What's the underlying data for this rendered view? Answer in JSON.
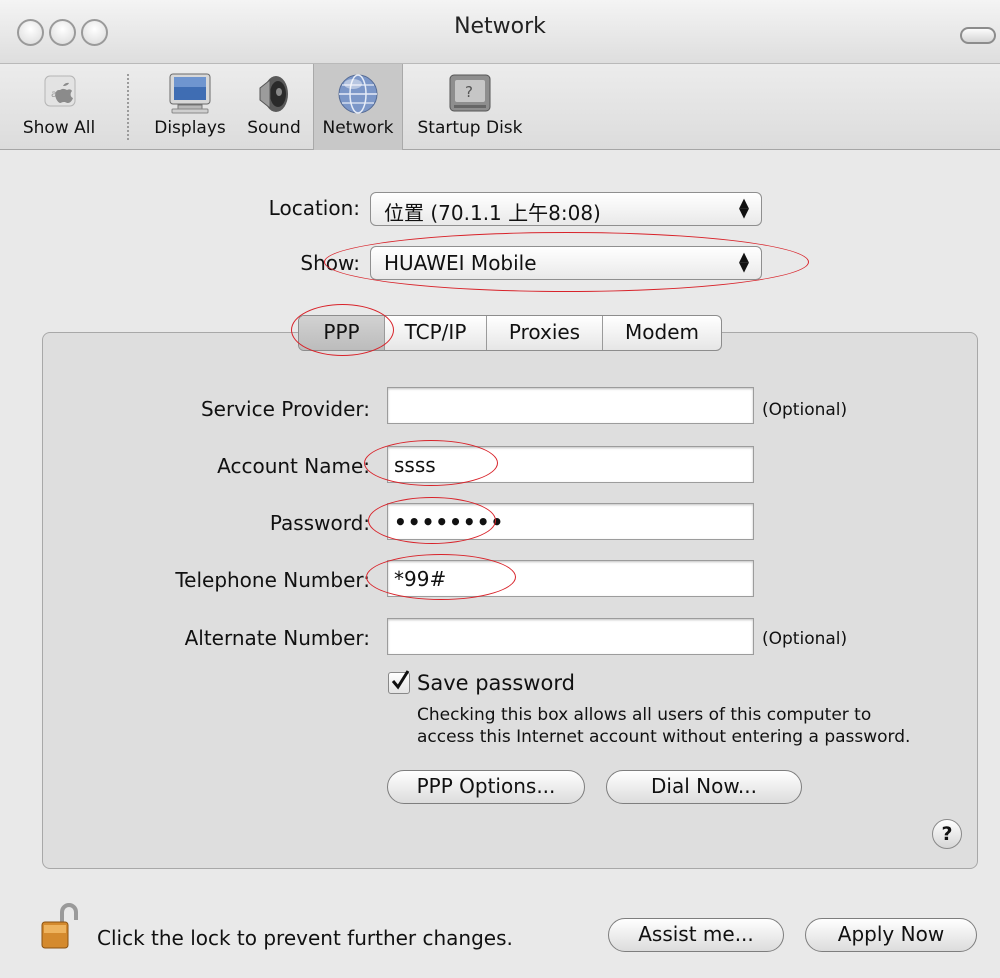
{
  "window": {
    "title": "Network"
  },
  "toolbar": {
    "items": [
      {
        "label": "Show All",
        "icon": "show-all-icon"
      },
      {
        "label": "Displays",
        "icon": "displays-icon"
      },
      {
        "label": "Sound",
        "icon": "sound-icon"
      },
      {
        "label": "Network",
        "icon": "network-icon"
      },
      {
        "label": "Startup Disk",
        "icon": "startup-disk-icon"
      }
    ]
  },
  "location": {
    "label": "Location:",
    "value": "位置 (70.1.1 上午8:08)"
  },
  "show": {
    "label": "Show:",
    "value": "HUAWEI Mobile"
  },
  "tabs": [
    {
      "label": "PPP",
      "selected": true
    },
    {
      "label": "TCP/IP",
      "selected": false
    },
    {
      "label": "Proxies",
      "selected": false
    },
    {
      "label": "Modem",
      "selected": false
    }
  ],
  "form": {
    "service_provider": {
      "label": "Service Provider:",
      "value": "",
      "hint": "(Optional)"
    },
    "account_name": {
      "label": "Account Name:",
      "value": "ssss"
    },
    "password": {
      "label": "Password:",
      "value": "••••••••"
    },
    "telephone_number": {
      "label": "Telephone Number:",
      "value": "*99#"
    },
    "alternate_number": {
      "label": "Alternate Number:",
      "value": "",
      "hint": "(Optional)"
    },
    "save_password": {
      "label": "Save password",
      "checked": true,
      "note_line1": "Checking this box allows all users of this computer to",
      "note_line2": "access this Internet account without entering a password."
    },
    "ppp_options_button": "PPP Options...",
    "dial_now_button": "Dial Now...",
    "help": "?"
  },
  "footer": {
    "lock_text": "Click the lock to prevent further changes.",
    "assist_button": "Assist me...",
    "apply_button": "Apply Now"
  },
  "colors": {
    "annotation": "#d8232a",
    "window_bg": "#e9e9e9",
    "panel_bg": "#dedede"
  }
}
